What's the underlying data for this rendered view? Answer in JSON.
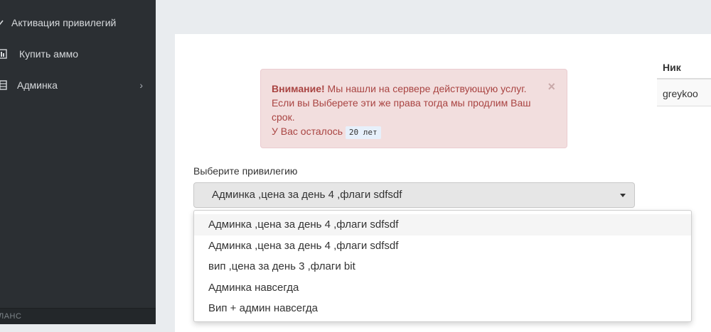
{
  "sidebar": {
    "items": [
      {
        "label": "Активация привилегий",
        "icon": "chevron-down-icon"
      },
      {
        "label": "Купить аммо",
        "icon": "bar-chart-icon"
      },
      {
        "label": "Админка",
        "icon": "table-icon",
        "chevron": "›"
      }
    ],
    "bottom_label": "ЛАНС"
  },
  "alert": {
    "title": "Внимание!",
    "message": "Мы нашли на сервере действующую услуг. Если вы Выберете эти же права тогда мы продлим Ваш срок.",
    "remaining_label": "У Вас осталось",
    "remaining_value": "20 лет",
    "close_symbol": "×"
  },
  "privilege": {
    "label": "Выберите привилегию",
    "selected": "Админка ,цена за день 4 ,флаги sdfsdf",
    "options": [
      "Админка ,цена за день 4 ,флаги sdfsdf",
      "Админка ,цена за день 4 ,флаги sdfsdf",
      "вип ,цена за день 3 ,флаги bit",
      "Админка навсегда",
      "Вип + админ навсегда"
    ]
  },
  "table": {
    "header": "Ник",
    "rows": [
      "greykoo"
    ]
  },
  "colors": {
    "sidebar_bg": "#2b2f33",
    "alert_bg": "#f2dede",
    "alert_text": "#a94442"
  }
}
